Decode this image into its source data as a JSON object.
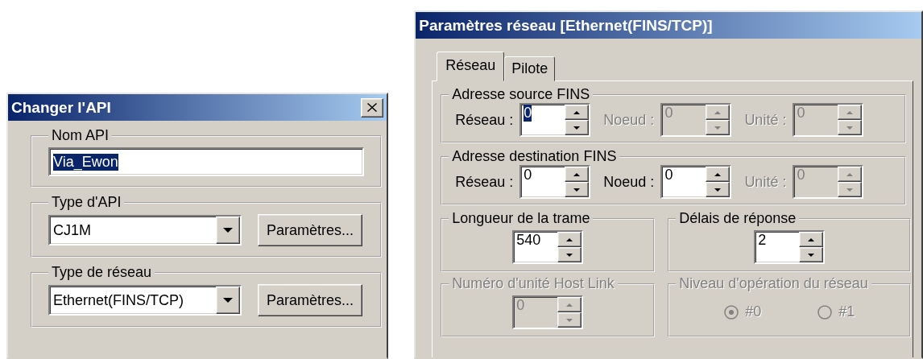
{
  "left_dialog": {
    "title": "Changer l'API",
    "groups": [
      {
        "kind": "text",
        "label": "Nom API",
        "value": "Via_Ewon",
        "text_selected": true
      },
      {
        "kind": "combo",
        "label": "Type d'API",
        "value": "CJ1M",
        "button": "Paramètres..."
      },
      {
        "kind": "combo",
        "label": "Type de réseau",
        "value": "Ethernet(FINS/TCP)",
        "button": "Paramètres..."
      }
    ]
  },
  "right_dialog": {
    "title": "Paramètres réseau [Ethernet(FINS/TCP)]",
    "tabs": [
      {
        "label": "Réseau",
        "selected": true
      },
      {
        "label": "Pilote",
        "selected": false
      }
    ],
    "address_groups": [
      {
        "label": "Adresse source FINS",
        "fields": [
          {
            "label": "Réseau :",
            "value": "0",
            "disabled": false,
            "text_selected": true
          },
          {
            "label": "Noeud :",
            "value": "0",
            "disabled": true,
            "text_selected": false
          },
          {
            "label": "Unité :",
            "value": "0",
            "disabled": true,
            "text_selected": false
          }
        ]
      },
      {
        "label": "Adresse destination FINS",
        "fields": [
          {
            "label": "Réseau :",
            "value": "0",
            "disabled": false,
            "text_selected": false
          },
          {
            "label": "Noeud :",
            "value": "0",
            "disabled": false,
            "text_selected": false
          },
          {
            "label": "Unité :",
            "value": "0",
            "disabled": true,
            "text_selected": false
          }
        ]
      }
    ],
    "option_groups": [
      {
        "kind": "spin",
        "label": "Longueur de la trame",
        "disabled": false,
        "value": "540"
      },
      {
        "kind": "spin",
        "label": "Délais de réponse",
        "disabled": false,
        "value": "2"
      },
      {
        "kind": "spin",
        "label": "Numéro d'unité Host Link",
        "disabled": true,
        "value": "0"
      },
      {
        "kind": "radio",
        "label": "Niveau d'opération du réseau",
        "disabled": true,
        "options": [
          {
            "label": "#0",
            "selected": true
          },
          {
            "label": "#1",
            "selected": false
          }
        ]
      }
    ]
  }
}
